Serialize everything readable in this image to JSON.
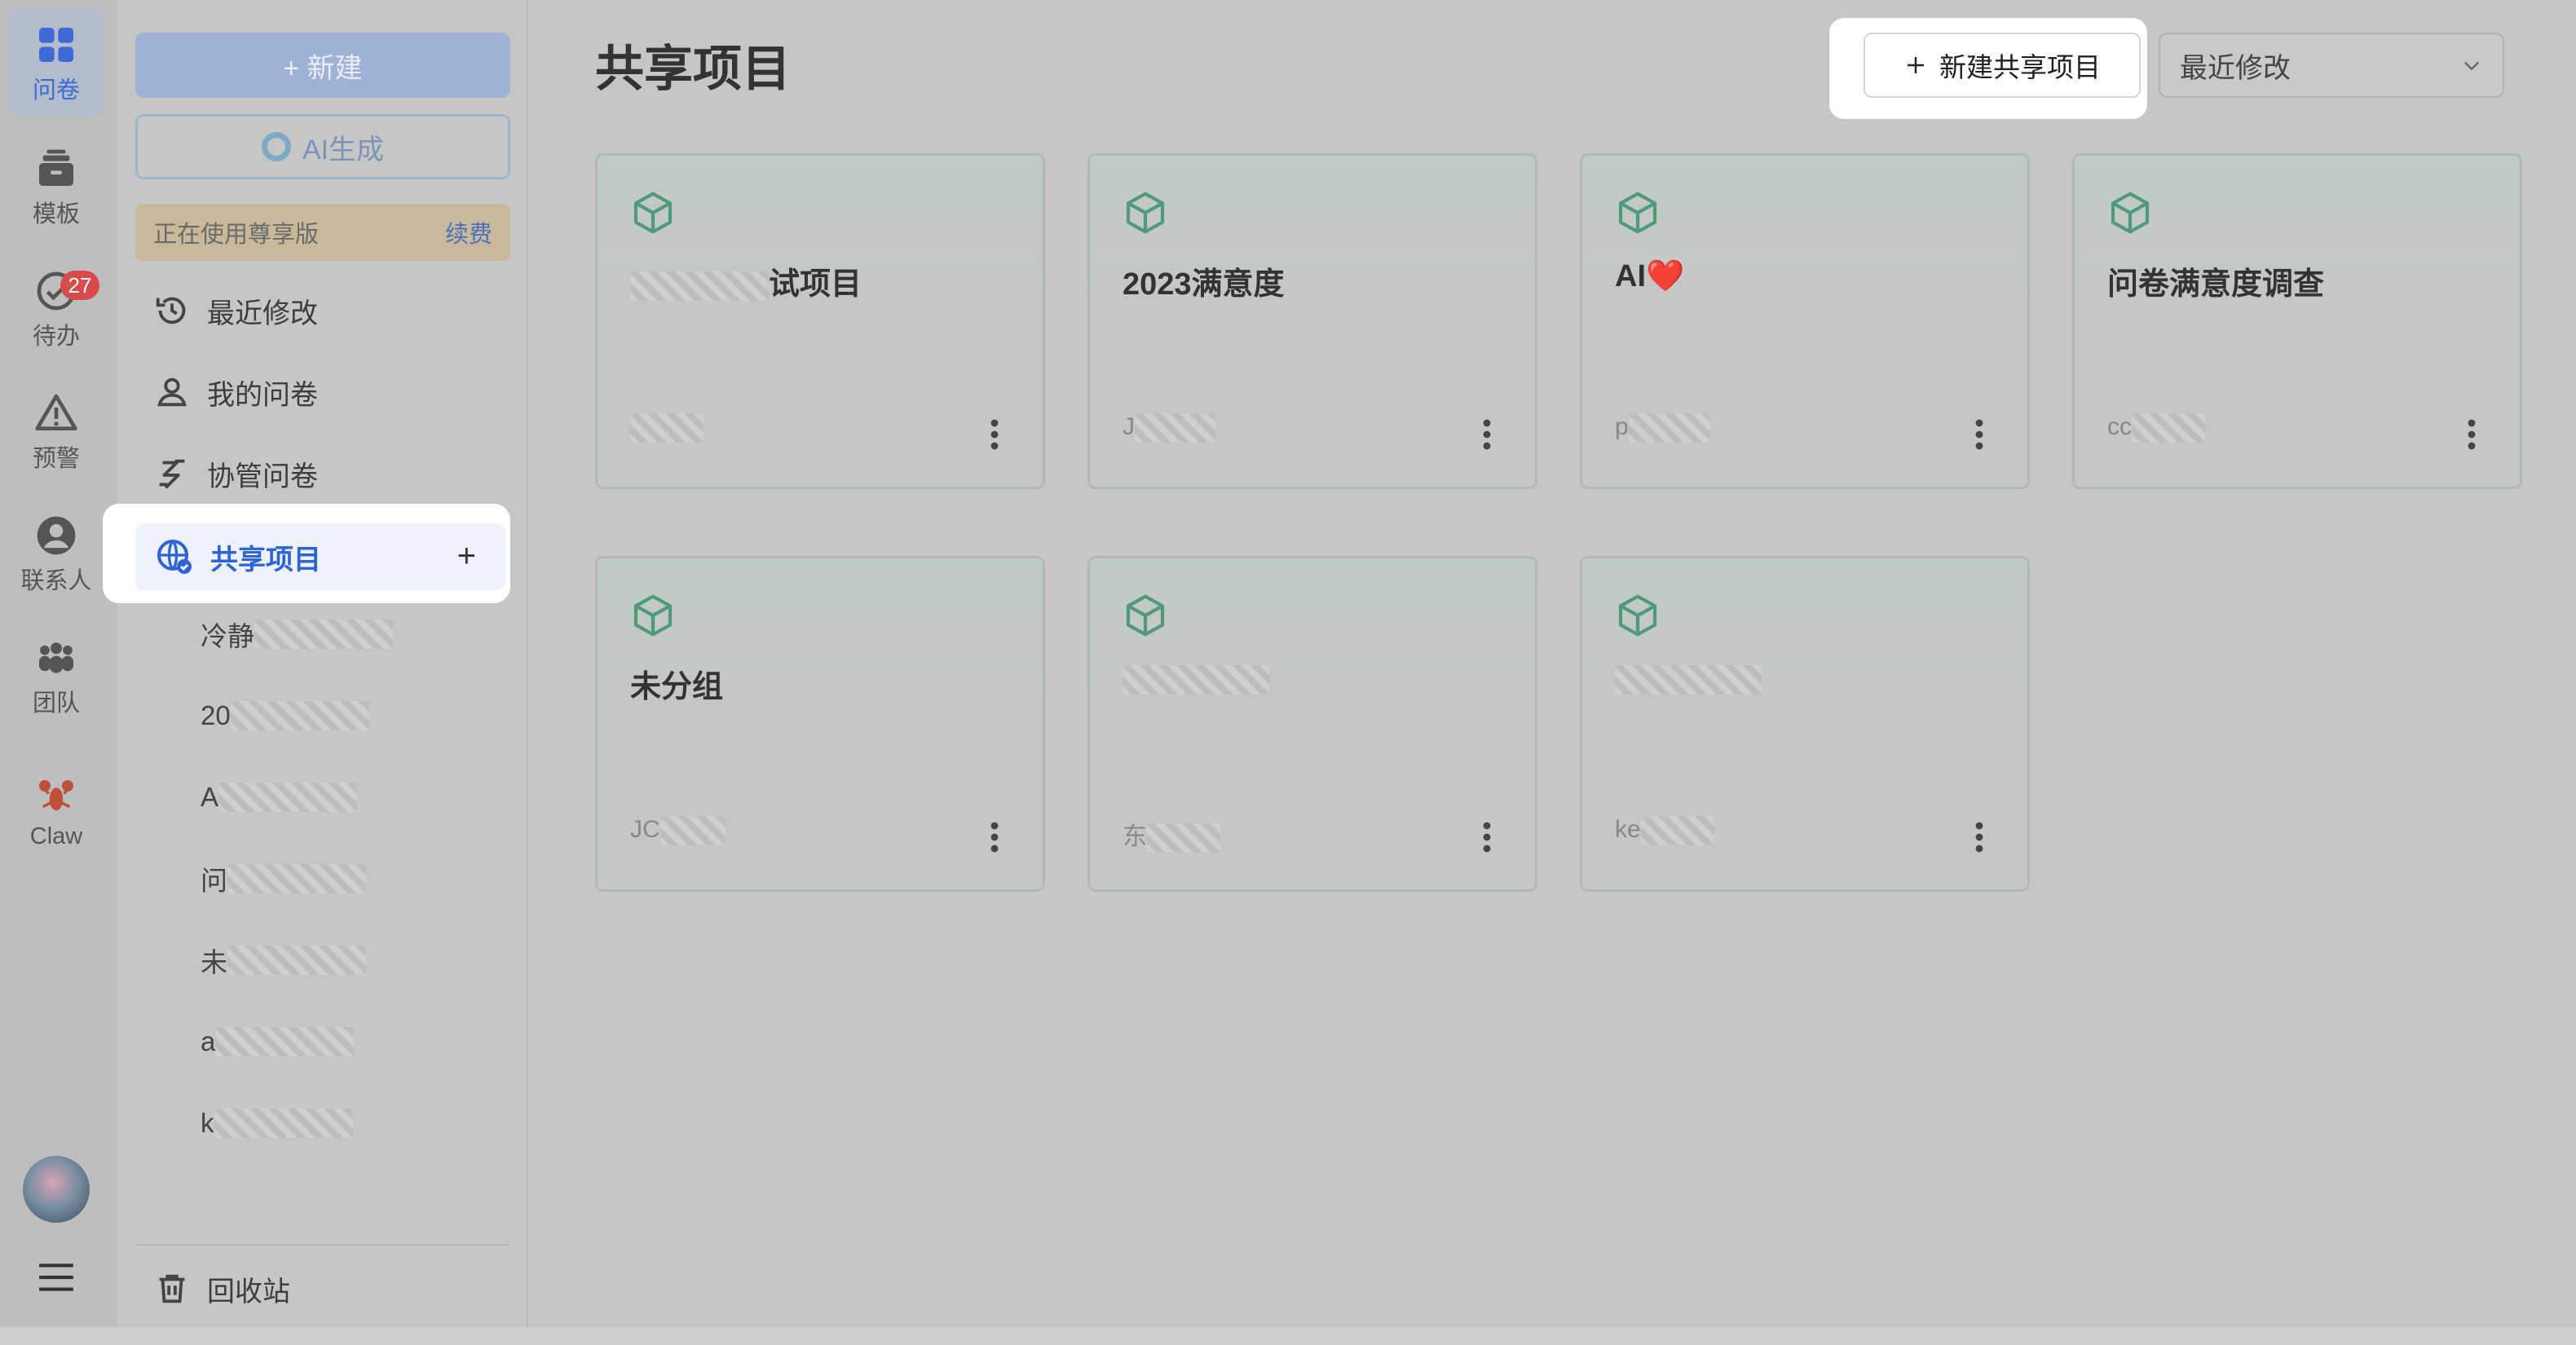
{
  "rail": {
    "items": [
      {
        "label": "问卷",
        "icon": "grid-icon",
        "active": true
      },
      {
        "label": "模板",
        "icon": "template-icon"
      },
      {
        "label": "待办",
        "icon": "todo-check-icon",
        "badge": "27"
      },
      {
        "label": "预警",
        "icon": "warning-icon"
      },
      {
        "label": "联系人",
        "icon": "contact-icon"
      },
      {
        "label": "团队",
        "icon": "team-icon"
      },
      {
        "label": "Claw",
        "icon": "lobster-icon"
      }
    ]
  },
  "sidebar": {
    "new_button": "+ 新建",
    "ai_button": "AI生成",
    "plan_text": "正在使用尊享版",
    "renew_link": "续费",
    "nav": [
      {
        "label": "最近修改",
        "icon": "history-icon"
      },
      {
        "label": "我的问卷",
        "icon": "user-icon"
      },
      {
        "label": "协管问卷",
        "icon": "collab-icon"
      }
    ],
    "active_item": {
      "label": "共享项目",
      "icon": "globe-share-icon",
      "add": "+"
    },
    "sub_items": [
      "冷静",
      "20",
      "A",
      "问",
      "未",
      "a",
      "k"
    ],
    "trash_label": "回收站"
  },
  "main": {
    "title": "共享项目",
    "new_share_button": "新建共享项目",
    "sort": {
      "selected": "最近修改"
    },
    "cards": [
      {
        "title": "试项目",
        "owner": ""
      },
      {
        "title": "2023满意度",
        "owner": "J"
      },
      {
        "title": "AI❤️",
        "owner": "p"
      },
      {
        "title": "问卷满意度调查",
        "owner": "cc"
      },
      {
        "title": "未分组",
        "owner": "JC"
      },
      {
        "title": "",
        "owner": "东"
      },
      {
        "title": "",
        "owner": "ke"
      }
    ]
  },
  "colors": {
    "accent": "#2f63d6",
    "cube": "#4f9a7a",
    "badge": "#d94a4a"
  }
}
